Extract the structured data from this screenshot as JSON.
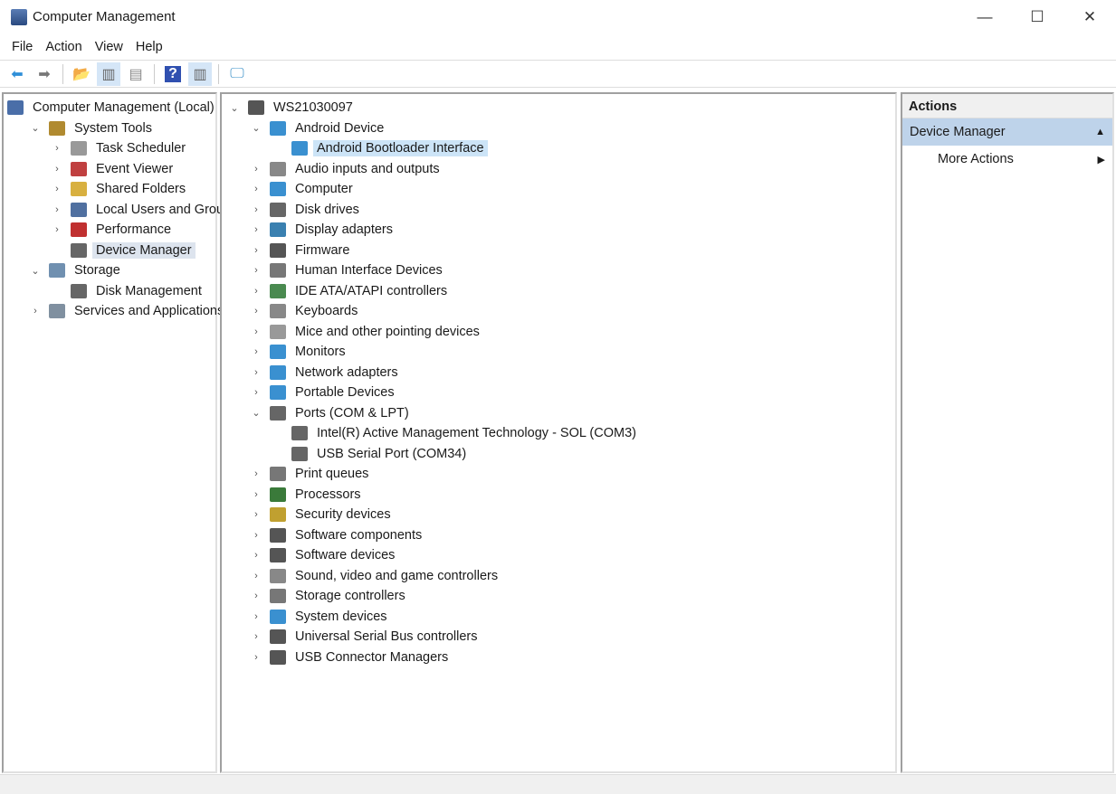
{
  "window": {
    "title": "Computer Management",
    "minimize": "—",
    "maximize": "☐",
    "close": "✕"
  },
  "menu": [
    "File",
    "Action",
    "View",
    "Help"
  ],
  "toolbar": [
    {
      "name": "back-button",
      "glyph": "⬅",
      "color": "#2f8fd8"
    },
    {
      "name": "forward-button",
      "glyph": "➡",
      "color": "#777"
    },
    {
      "sep": true
    },
    {
      "name": "up-folder-button",
      "glyph": "📂",
      "color": "#d8b040"
    },
    {
      "name": "show-hide-console-tree-button",
      "glyph": "▥",
      "color": "#666",
      "on": true
    },
    {
      "name": "properties-button",
      "glyph": "▤",
      "color": "#888"
    },
    {
      "sep": true
    },
    {
      "name": "help-button",
      "glyph": "?",
      "color": "#fff",
      "bg": "#3050b0"
    },
    {
      "name": "show-hide-action-pane-button",
      "glyph": "▥",
      "color": "#666",
      "on": true
    },
    {
      "sep": true
    },
    {
      "name": "scan-hardware-button",
      "glyph": "🖵",
      "color": "#3a90c8"
    }
  ],
  "left_tree": [
    {
      "label": "Computer Management (Local)",
      "level": 0,
      "chev": "",
      "color": "#4a6ea8"
    },
    {
      "label": "System Tools",
      "level": 1,
      "chev": "⌄",
      "color": "#b08a30"
    },
    {
      "label": "Task Scheduler",
      "level": 2,
      "chev": "›",
      "color": "#999"
    },
    {
      "label": "Event Viewer",
      "level": 2,
      "chev": "›",
      "color": "#c04040"
    },
    {
      "label": "Shared Folders",
      "level": 2,
      "chev": "›",
      "color": "#d8b040"
    },
    {
      "label": "Local Users and Groups",
      "level": 2,
      "chev": "›",
      "color": "#5070a0"
    },
    {
      "label": "Performance",
      "level": 2,
      "chev": "›",
      "color": "#c03030"
    },
    {
      "label": "Device Manager",
      "level": 2,
      "chev": "",
      "color": "#666",
      "selected": true
    },
    {
      "label": "Storage",
      "level": 1,
      "chev": "⌄",
      "color": "#7090b0"
    },
    {
      "label": "Disk Management",
      "level": 2,
      "chev": "",
      "color": "#666"
    },
    {
      "label": "Services and Applications",
      "level": 1,
      "chev": "›",
      "color": "#8090a0"
    }
  ],
  "device_tree": [
    {
      "label": "WS21030097",
      "level": 0,
      "chev": "⌄",
      "color": "#555"
    },
    {
      "label": "Android Device",
      "level": 1,
      "chev": "⌄",
      "color": "#3a90d0"
    },
    {
      "label": "Android Bootloader Interface",
      "level": 2,
      "chev": "",
      "color": "#3a90d0",
      "selected": true
    },
    {
      "label": "Audio inputs and outputs",
      "level": 1,
      "chev": "›",
      "color": "#888"
    },
    {
      "label": "Computer",
      "level": 1,
      "chev": "›",
      "color": "#3a90d0"
    },
    {
      "label": "Disk drives",
      "level": 1,
      "chev": "›",
      "color": "#666"
    },
    {
      "label": "Display adapters",
      "level": 1,
      "chev": "›",
      "color": "#3a80b0"
    },
    {
      "label": "Firmware",
      "level": 1,
      "chev": "›",
      "color": "#555"
    },
    {
      "label": "Human Interface Devices",
      "level": 1,
      "chev": "›",
      "color": "#777"
    },
    {
      "label": "IDE ATA/ATAPI controllers",
      "level": 1,
      "chev": "›",
      "color": "#4a8a50"
    },
    {
      "label": "Keyboards",
      "level": 1,
      "chev": "›",
      "color": "#888"
    },
    {
      "label": "Mice and other pointing devices",
      "level": 1,
      "chev": "›",
      "color": "#999"
    },
    {
      "label": "Monitors",
      "level": 1,
      "chev": "›",
      "color": "#3a90d0"
    },
    {
      "label": "Network adapters",
      "level": 1,
      "chev": "›",
      "color": "#3a90d0"
    },
    {
      "label": "Portable Devices",
      "level": 1,
      "chev": "›",
      "color": "#3a90d0"
    },
    {
      "label": "Ports (COM & LPT)",
      "level": 1,
      "chev": "⌄",
      "color": "#666"
    },
    {
      "label": "Intel(R) Active Management Technology - SOL (COM3)",
      "level": 2,
      "chev": "",
      "color": "#666"
    },
    {
      "label": "USB Serial Port (COM34)",
      "level": 2,
      "chev": "",
      "color": "#666"
    },
    {
      "label": "Print queues",
      "level": 1,
      "chev": "›",
      "color": "#777"
    },
    {
      "label": "Processors",
      "level": 1,
      "chev": "›",
      "color": "#3a7a3a"
    },
    {
      "label": "Security devices",
      "level": 1,
      "chev": "›",
      "color": "#c0a030"
    },
    {
      "label": "Software components",
      "level": 1,
      "chev": "›",
      "color": "#555"
    },
    {
      "label": "Software devices",
      "level": 1,
      "chev": "›",
      "color": "#555"
    },
    {
      "label": "Sound, video and game controllers",
      "level": 1,
      "chev": "›",
      "color": "#888"
    },
    {
      "label": "Storage controllers",
      "level": 1,
      "chev": "›",
      "color": "#777"
    },
    {
      "label": "System devices",
      "level": 1,
      "chev": "›",
      "color": "#3a90d0"
    },
    {
      "label": "Universal Serial Bus controllers",
      "level": 1,
      "chev": "›",
      "color": "#555"
    },
    {
      "label": "USB Connector Managers",
      "level": 1,
      "chev": "›",
      "color": "#555"
    }
  ],
  "actions": {
    "header": "Actions",
    "section": "Device Manager",
    "section_arrow": "▲",
    "item": "More Actions",
    "item_arrow": "▶"
  }
}
